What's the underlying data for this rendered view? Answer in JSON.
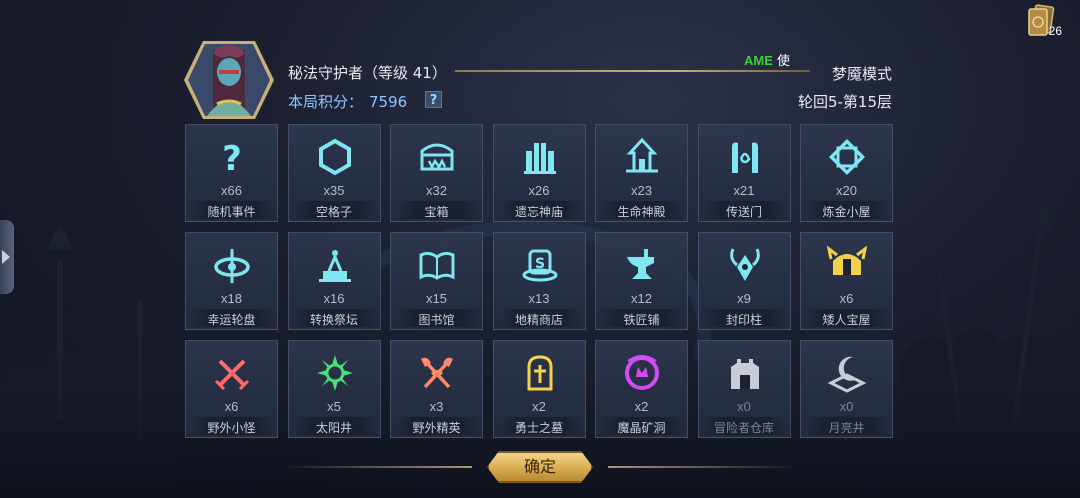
{
  "header": {
    "player_name": "秘法守护者（等级 41）",
    "overlay_green": "AME",
    "overlay_white": "使",
    "score_label": "本局积分：",
    "score_value": "7596",
    "help_glyph": "?",
    "mode": "梦魇模式",
    "round": "轮回5-第15层"
  },
  "top_right": {
    "icon": "card-deck-icon",
    "count": "26"
  },
  "colors": {
    "tile_icon_active": "#7fe6f2",
    "tile_icon_dim": "#c9ccd4",
    "accent_gold": "#d9ac4f",
    "score_blue": "#8fc6ff"
  },
  "tiles": [
    {
      "icon": "question-mark-icon",
      "count": "x66",
      "name": "随机事件"
    },
    {
      "icon": "hexagon-icon",
      "count": "x35",
      "name": "空格子"
    },
    {
      "icon": "treasure-chest-icon",
      "count": "x32",
      "name": "宝箱"
    },
    {
      "icon": "temple-pillars-icon",
      "count": "x26",
      "name": "遗忘神庙"
    },
    {
      "icon": "shrine-icon",
      "count": "x23",
      "name": "生命神殿"
    },
    {
      "icon": "portal-gate-icon",
      "count": "x21",
      "name": "传送门"
    },
    {
      "icon": "alchemy-star-icon",
      "count": "x20",
      "name": "炼金小屋"
    },
    {
      "icon": "roulette-wheel-icon",
      "count": "x18",
      "name": "幸运轮盘"
    },
    {
      "icon": "altar-icon",
      "count": "x16",
      "name": "转换祭坛"
    },
    {
      "icon": "open-book-icon",
      "count": "x15",
      "name": "图书馆"
    },
    {
      "icon": "spirit-shop-icon",
      "count": "x13",
      "name": "地精商店"
    },
    {
      "icon": "anvil-icon",
      "count": "x12",
      "name": "铁匠铺"
    },
    {
      "icon": "seal-pillar-icon",
      "count": "x9",
      "name": "封印柱"
    },
    {
      "icon": "dwarf-helmet-icon",
      "count": "x6",
      "name": "矮人宝屋"
    },
    {
      "icon": "crossed-swords-icon",
      "count": "x6",
      "name": "野外小怪"
    },
    {
      "icon": "sun-well-icon",
      "count": "x5",
      "name": "太阳井"
    },
    {
      "icon": "crossed-axes-icon",
      "count": "x3",
      "name": "野外精英"
    },
    {
      "icon": "tombstone-icon",
      "count": "x2",
      "name": "勇士之墓"
    },
    {
      "icon": "crystal-mine-icon",
      "count": "x2",
      "name": "魔晶矿洞"
    },
    {
      "icon": "warehouse-icon",
      "count": "x0",
      "name": "冒险者仓库"
    },
    {
      "icon": "moon-well-icon",
      "count": "x0",
      "name": "月亮井"
    }
  ],
  "confirm_label": "确定"
}
